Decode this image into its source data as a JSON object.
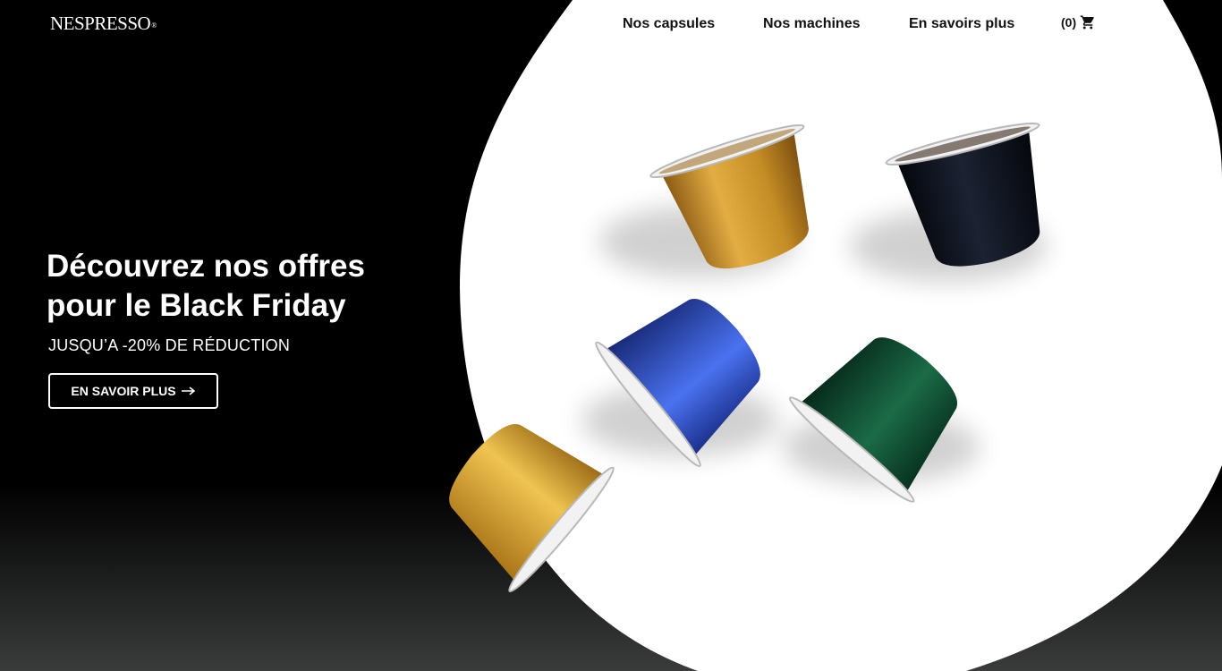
{
  "brand": {
    "logo_text": "Nespresso",
    "logo_mark": "®"
  },
  "nav": {
    "items": [
      {
        "label": "Nos capsules"
      },
      {
        "label": "Nos machines"
      },
      {
        "label": "En savoirs plus"
      }
    ],
    "cart": {
      "count": "(0)",
      "icon": "cart-icon"
    }
  },
  "hero": {
    "title": "Découvrez nos offres pour le Black Friday",
    "subtitle": "JUSQU’A -20% DE RÉDUCTION",
    "button_label": "EN SAVOIR PLUS",
    "button_icon": "arrow-right-icon"
  },
  "colors": {
    "background": "#000000",
    "blob": "#ffffff",
    "capsule_gold": "#d9a433",
    "capsule_black": "#141824",
    "capsule_blue": "#2f55d6",
    "capsule_green": "#145a3a",
    "capsule_yellow": "#e6b635"
  }
}
